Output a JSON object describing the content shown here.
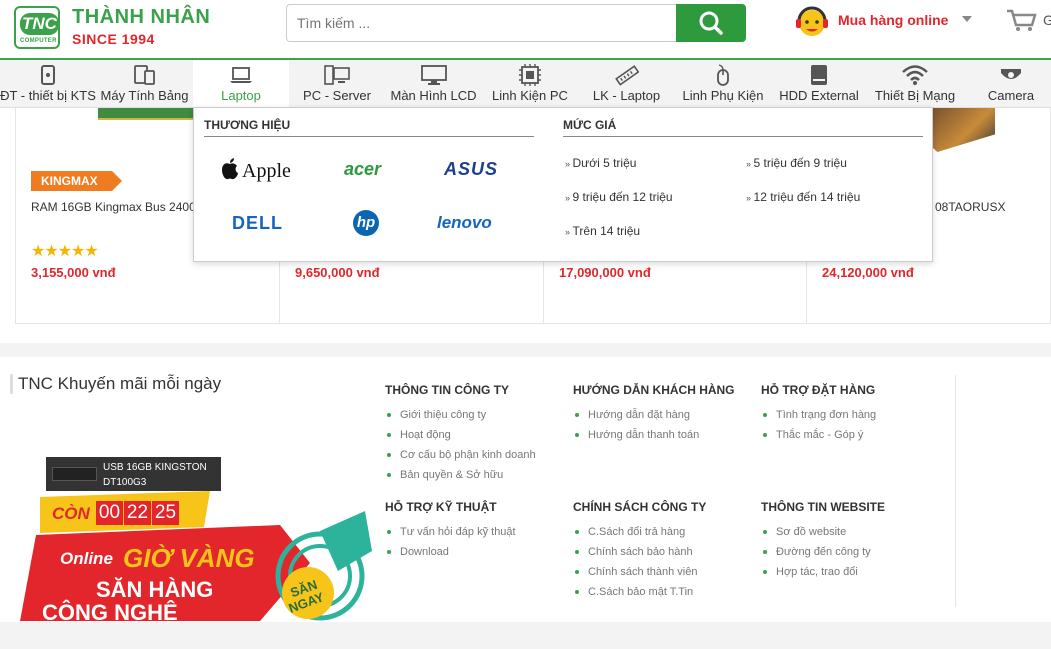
{
  "header": {
    "logo_text": "TNC",
    "logo_sub": "COMPUTER",
    "brand_name": "THÀNH NHÂN",
    "since": "SINCE 1994",
    "search_placeholder": "Tìm kiếm ...",
    "online_label": "Mua hàng online",
    "cart_label": "G"
  },
  "nav": {
    "items": [
      {
        "label": "ĐT - thiết bị KTS",
        "icon": "phone-icon"
      },
      {
        "label": "Máy Tính Bảng",
        "icon": "tablet-icon"
      },
      {
        "label": "Laptop",
        "icon": "laptop-icon"
      },
      {
        "label": "PC - Server",
        "icon": "pc-server-icon"
      },
      {
        "label": "Màn Hình LCD",
        "icon": "monitor-icon"
      },
      {
        "label": "Linh Kiện PC",
        "icon": "chip-icon"
      },
      {
        "label": "LK - Laptop",
        "icon": "ram-icon"
      },
      {
        "label": "Linh Phụ Kiện",
        "icon": "mouse-icon"
      },
      {
        "label": "HDD External",
        "icon": "hdd-icon"
      },
      {
        "label": "Thiết Bị Mạng",
        "icon": "wifi-icon"
      },
      {
        "label": "Camera",
        "icon": "camera-icon"
      }
    ]
  },
  "dropdown": {
    "brands_title": "THƯƠNG HIỆU",
    "brands": [
      "Apple",
      "acer",
      "ASUS",
      "DELL",
      "hp",
      "lenovo"
    ],
    "price_title": "MỨC GIÁ",
    "prices": [
      "Dưới 5 triệu",
      "5 triệu đến 9 triệu",
      "9 triệu đến 12 triệu",
      "12 triệu đến 14 triệu",
      "Trên 14 triệu"
    ]
  },
  "products": [
    {
      "badge": "KINGMAX",
      "name": "RAM 16GB Kingmax Bus 2400",
      "stars": "★★★★★",
      "price": "3,155,000 vnđ"
    },
    {
      "price": "9,650,000 vnđ"
    },
    {
      "price": "17,090,000 vnđ"
    },
    {
      "name": "08TAORUSX",
      "price": "24,120,000 vnđ"
    }
  ],
  "promo": {
    "title": "TNC Khuyến mãi mỗi ngày",
    "product_line1": "USB 16GB KINGSTON",
    "product_line2": "DT100G3",
    "con": "CÒN",
    "hh": "00",
    "mm": "22",
    "ss": "25",
    "online": "Online",
    "gio_vang": "GIỜ VÀNG",
    "san_hang": "SĂN HÀNG",
    "cong_nghe": "CÔNG NGHỆ",
    "san_ngay_1": "SĂN",
    "san_ngay_2": "NGAY"
  },
  "footer": {
    "columns": [
      {
        "title": "THÔNG TIN CÔNG TY",
        "items": [
          "Giới thiệu công ty",
          "Hoạt động",
          "Cơ cấu bộ phận kinh doanh",
          "Bản quyền & Sở hữu"
        ]
      },
      {
        "title": "HƯỚNG DẪN KHÁCH HÀNG",
        "items": [
          "Hướng dẫn đặt hàng",
          "Hướng dẫn thanh toán"
        ]
      },
      {
        "title": "HỖ TRỢ ĐẶT HÀNG",
        "items": [
          "Tình trạng đơn hàng",
          "Thắc mắc - Góp ý"
        ]
      },
      {
        "title": "HỖ TRỢ KỸ THUẬT",
        "items": [
          "Tư vấn hỏi đáp kỹ thuật",
          "Download"
        ]
      },
      {
        "title": "CHÍNH SÁCH CÔNG TY",
        "items": [
          "C.Sách đổi trả hàng",
          "Chính sách bảo hành",
          "Chính sách thành viên",
          "C.Sách bảo mật T.Tin"
        ]
      },
      {
        "title": "THÔNG TIN WEBSITE",
        "items": [
          "Sơ đồ website",
          "Đường đến công ty",
          "Hợp tác, trao đổi"
        ]
      }
    ]
  },
  "colors": {
    "brand_green": "#3aa24a",
    "price_red": "#e2262b",
    "badge_orange": "#f07c22"
  }
}
